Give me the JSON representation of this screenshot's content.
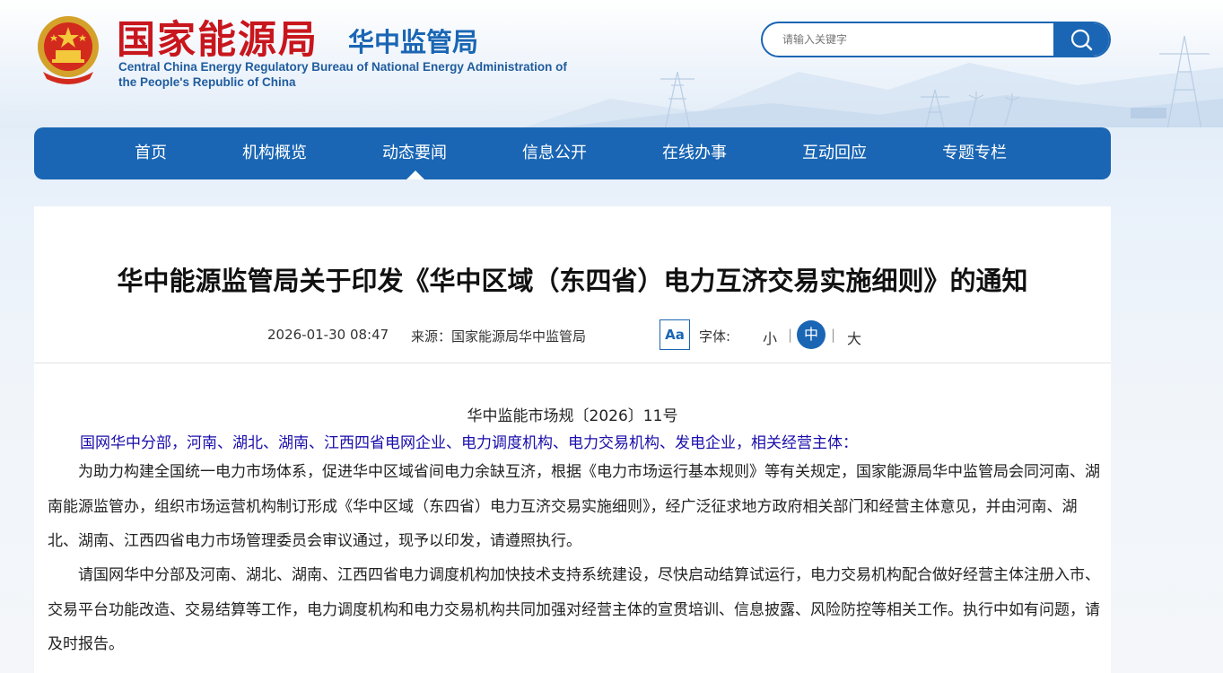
{
  "header": {
    "agency_cn": "国家能源局",
    "bureau_cn": "华中监管局",
    "agency_en": "Central China Energy Regulatory Bureau of National Energy Administration of the People's Republic of China",
    "emblem_icon": "national-emblem-icon",
    "search": {
      "placeholder": "请输入关键字",
      "button_icon": "search-icon"
    }
  },
  "nav": {
    "items": [
      {
        "label": "首页"
      },
      {
        "label": "机构概览"
      },
      {
        "label": "动态要闻"
      },
      {
        "label": "信息公开"
      },
      {
        "label": "在线办事"
      },
      {
        "label": "互动回应"
      },
      {
        "label": "专题专栏"
      }
    ],
    "active": "动态要闻"
  },
  "article": {
    "title": "华中能源监管局关于印发《华中区域（东四省）电力互济交易实施细则》的通知",
    "datetime": "2026-01-30 08:47",
    "source": "来源：国家能源局华中监管局",
    "font_icon_label": "Aa",
    "font_label": "字体:",
    "font_sizes": {
      "small": "小",
      "medium": "中",
      "large": "大"
    },
    "font_separator": "|",
    "font_selected": "中",
    "doc_number": "华中监能市场规〔2026〕11号",
    "addressee": "国网华中分部，河南、湖北、湖南、江西四省电网企业、电力调度机构、电力交易机构、发电企业，相关经营主体：",
    "paragraphs": [
      "为助力构建全国统一电力市场体系，促进华中区域省间电力余缺互济，根据《电力市场运行基本规则》等有关规定，国家能源局华中监管局会同河南、湖南能源监管办，组织市场运营机构制订形成《华中区域（东四省）电力互济交易实施细则》，经广泛征求地方政府相关部门和经营主体意见，并由河南、湖北、湖南、江西四省电力市场管理委员会审议通过，现予以印发，请遵照执行。",
      "请国网华中分部及河南、湖北、湖南、江西四省电力调度机构加快技术支持系统建设，尽快启动结算试运行，电力交易机构配合做好经营主体注册入市、交易平台功能改造、交易结算等工作，电力调度机构和电力交易机构共同加强对经营主体的宣贯培训、信息披露、风险防控等相关工作。执行中如有问题，请及时报告。"
    ]
  },
  "colors": {
    "brand_blue": "#1a66b4",
    "brand_red": "#c8161d",
    "addressee_blue": "#1a0dab"
  }
}
